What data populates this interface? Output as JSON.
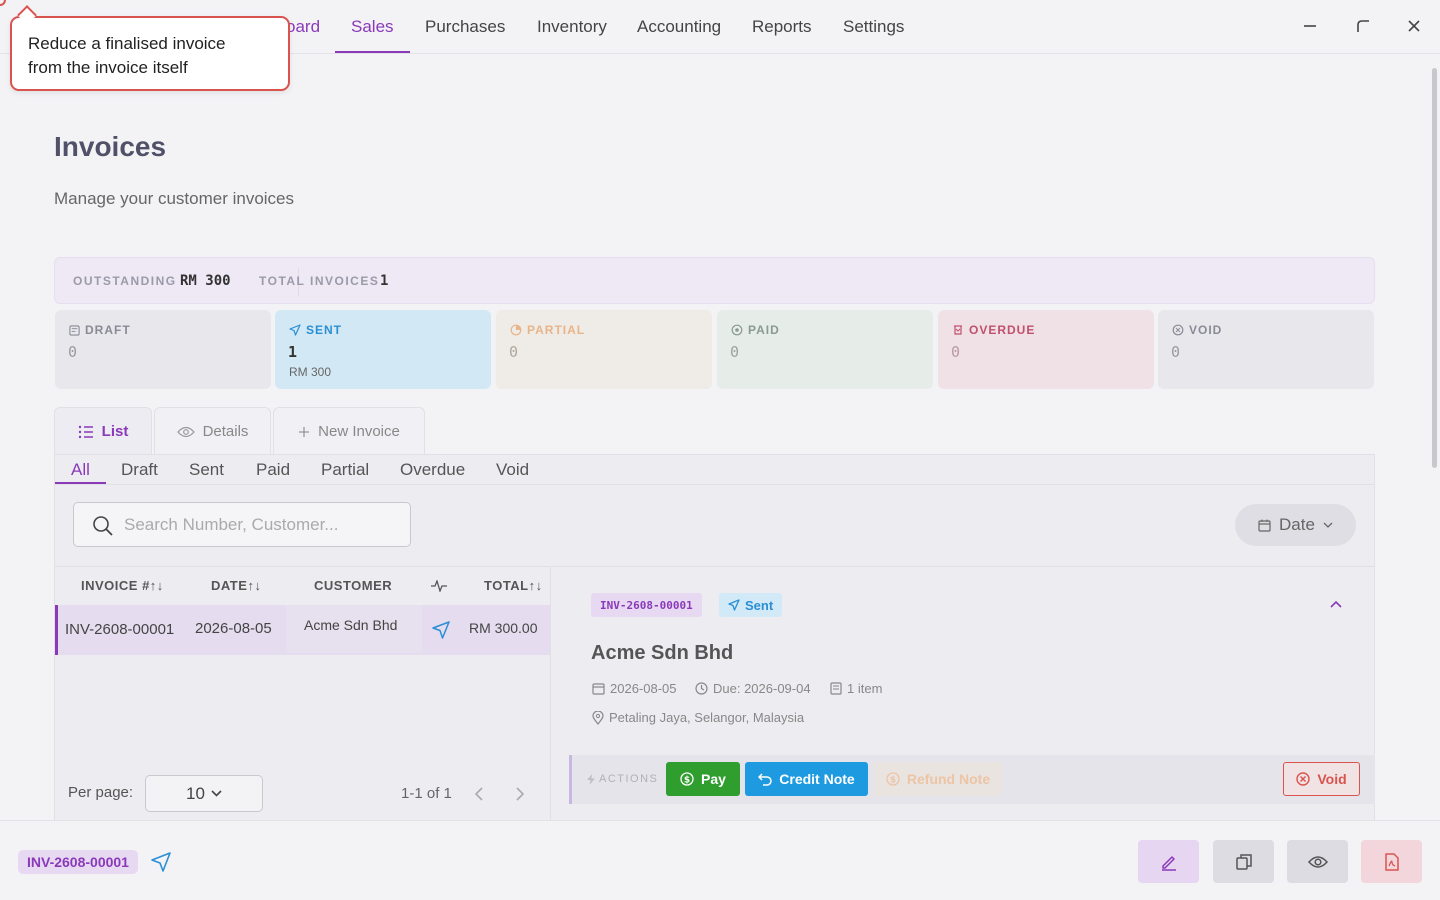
{
  "nav": {
    "items": [
      {
        "label": "oard",
        "active": false
      },
      {
        "label": "Sales",
        "active": true
      },
      {
        "label": "Purchases",
        "active": false
      },
      {
        "label": "Inventory",
        "active": false
      },
      {
        "label": "Accounting",
        "active": false
      },
      {
        "label": "Reports",
        "active": false
      },
      {
        "label": "Settings",
        "active": false
      }
    ],
    "window_controls": [
      "minimize-icon",
      "restore-icon",
      "close-icon"
    ]
  },
  "tooltip": {
    "line1": "Reduce a finalised invoice",
    "line2": "from the invoice itself"
  },
  "page": {
    "title": "Invoices",
    "subtitle": "Manage your customer invoices"
  },
  "summary": {
    "outstanding_label": "OUTSTANDING",
    "outstanding_value": "RM 300",
    "total_label": "TOTAL INVOICES",
    "total_value": "1"
  },
  "status_cards": [
    {
      "label": "DRAFT",
      "count": "0",
      "amount": "",
      "color": "#8a8a96",
      "bg": "#e8e8ec",
      "icon": "draft-icon"
    },
    {
      "label": "SENT",
      "count": "1",
      "amount": "RM 300",
      "color": "#2a8fd4",
      "bg": "#d3e8f5",
      "icon": "send-icon"
    },
    {
      "label": "PARTIAL",
      "count": "0",
      "amount": "",
      "color": "#e8b48a",
      "bg": "#efebe7",
      "icon": "partial-icon"
    },
    {
      "label": "PAID",
      "count": "0",
      "amount": "",
      "color": "#8a9a8e",
      "bg": "#e6ece8",
      "icon": "paid-icon"
    },
    {
      "label": "OVERDUE",
      "count": "0",
      "amount": "",
      "color": "#c0506e",
      "bg": "#f0e1e6",
      "icon": "overdue-icon"
    },
    {
      "label": "VOID",
      "count": "0",
      "amount": "",
      "color": "#8a8a96",
      "bg": "#e8e8ec",
      "icon": "void-icon"
    }
  ],
  "view_tabs": [
    {
      "label": "List",
      "active": true,
      "icon": "list-icon"
    },
    {
      "label": "Details",
      "active": false,
      "icon": "eye-icon"
    },
    {
      "label": "New Invoice",
      "active": false,
      "icon": "plus-icon"
    }
  ],
  "filter_tabs": [
    "All",
    "Draft",
    "Sent",
    "Paid",
    "Partial",
    "Overdue",
    "Void"
  ],
  "search": {
    "placeholder": "Search Number, Customer...",
    "value": ""
  },
  "date_button": {
    "label": "Date"
  },
  "table": {
    "headers": [
      "INVOICE #",
      "DATE",
      "CUSTOMER",
      "",
      "TOTAL"
    ],
    "sort_glyph": "↑↓",
    "rows": [
      {
        "number": "INV-2608-00001",
        "date": "2026-08-05",
        "customer": "Acme Sdn Bhd",
        "status_icon": "send-icon",
        "total": "RM 300.00"
      }
    ],
    "per_page_label": "Per page:",
    "per_page_value": "10",
    "pager_text": "1-1 of 1"
  },
  "detail": {
    "invoice_number": "INV-2608-00001",
    "status": "Sent",
    "customer": "Acme Sdn Bhd",
    "date": "2026-08-05",
    "due": "Due: 2026-09-04",
    "items": "1 item",
    "location": "Petaling Jaya, Selangor, Malaysia",
    "actions_label": "ACTIONS",
    "actions": {
      "pay": "Pay",
      "credit_note": "Credit Note",
      "refund_note": "Refund Note",
      "void": "Void"
    }
  },
  "bottom_bar": {
    "invoice_number": "INV-2608-00001",
    "buttons": [
      "edit-icon",
      "copy-icon",
      "eye-icon",
      "pdf-icon"
    ]
  },
  "colors": {
    "accent": "#8a3ab9",
    "sent_blue": "#2a8fd4",
    "pay_green": "#2f9e2f",
    "credit_blue": "#1e9be0",
    "void_red": "#d9534f"
  }
}
